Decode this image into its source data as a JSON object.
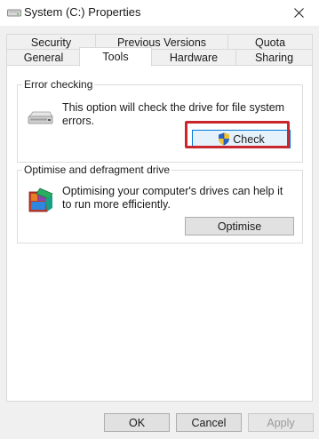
{
  "window": {
    "title": "System (C:) Properties"
  },
  "tabs": {
    "row1": [
      {
        "label": "Security"
      },
      {
        "label": "Previous Versions"
      },
      {
        "label": "Quota"
      }
    ],
    "row2": [
      {
        "label": "General"
      },
      {
        "label": "Tools",
        "active": true
      },
      {
        "label": "Hardware"
      },
      {
        "label": "Sharing"
      }
    ]
  },
  "error_checking": {
    "group_label": "Error checking",
    "description": "This option will check the drive for file system errors.",
    "check_button": "Check",
    "icon": "drive-icon"
  },
  "optimise": {
    "group_label": "Optimise and defragment drive",
    "description": "Optimising your computer's drives can help it to run more efficiently.",
    "optimise_button": "Optimise",
    "icon": "defrag-icon"
  },
  "footer": {
    "ok": "OK",
    "cancel": "Cancel",
    "apply": "Apply"
  },
  "colors": {
    "highlight": "#c8272d",
    "panel_bg": "#ffffff",
    "window_bg": "#f0f0f0"
  }
}
